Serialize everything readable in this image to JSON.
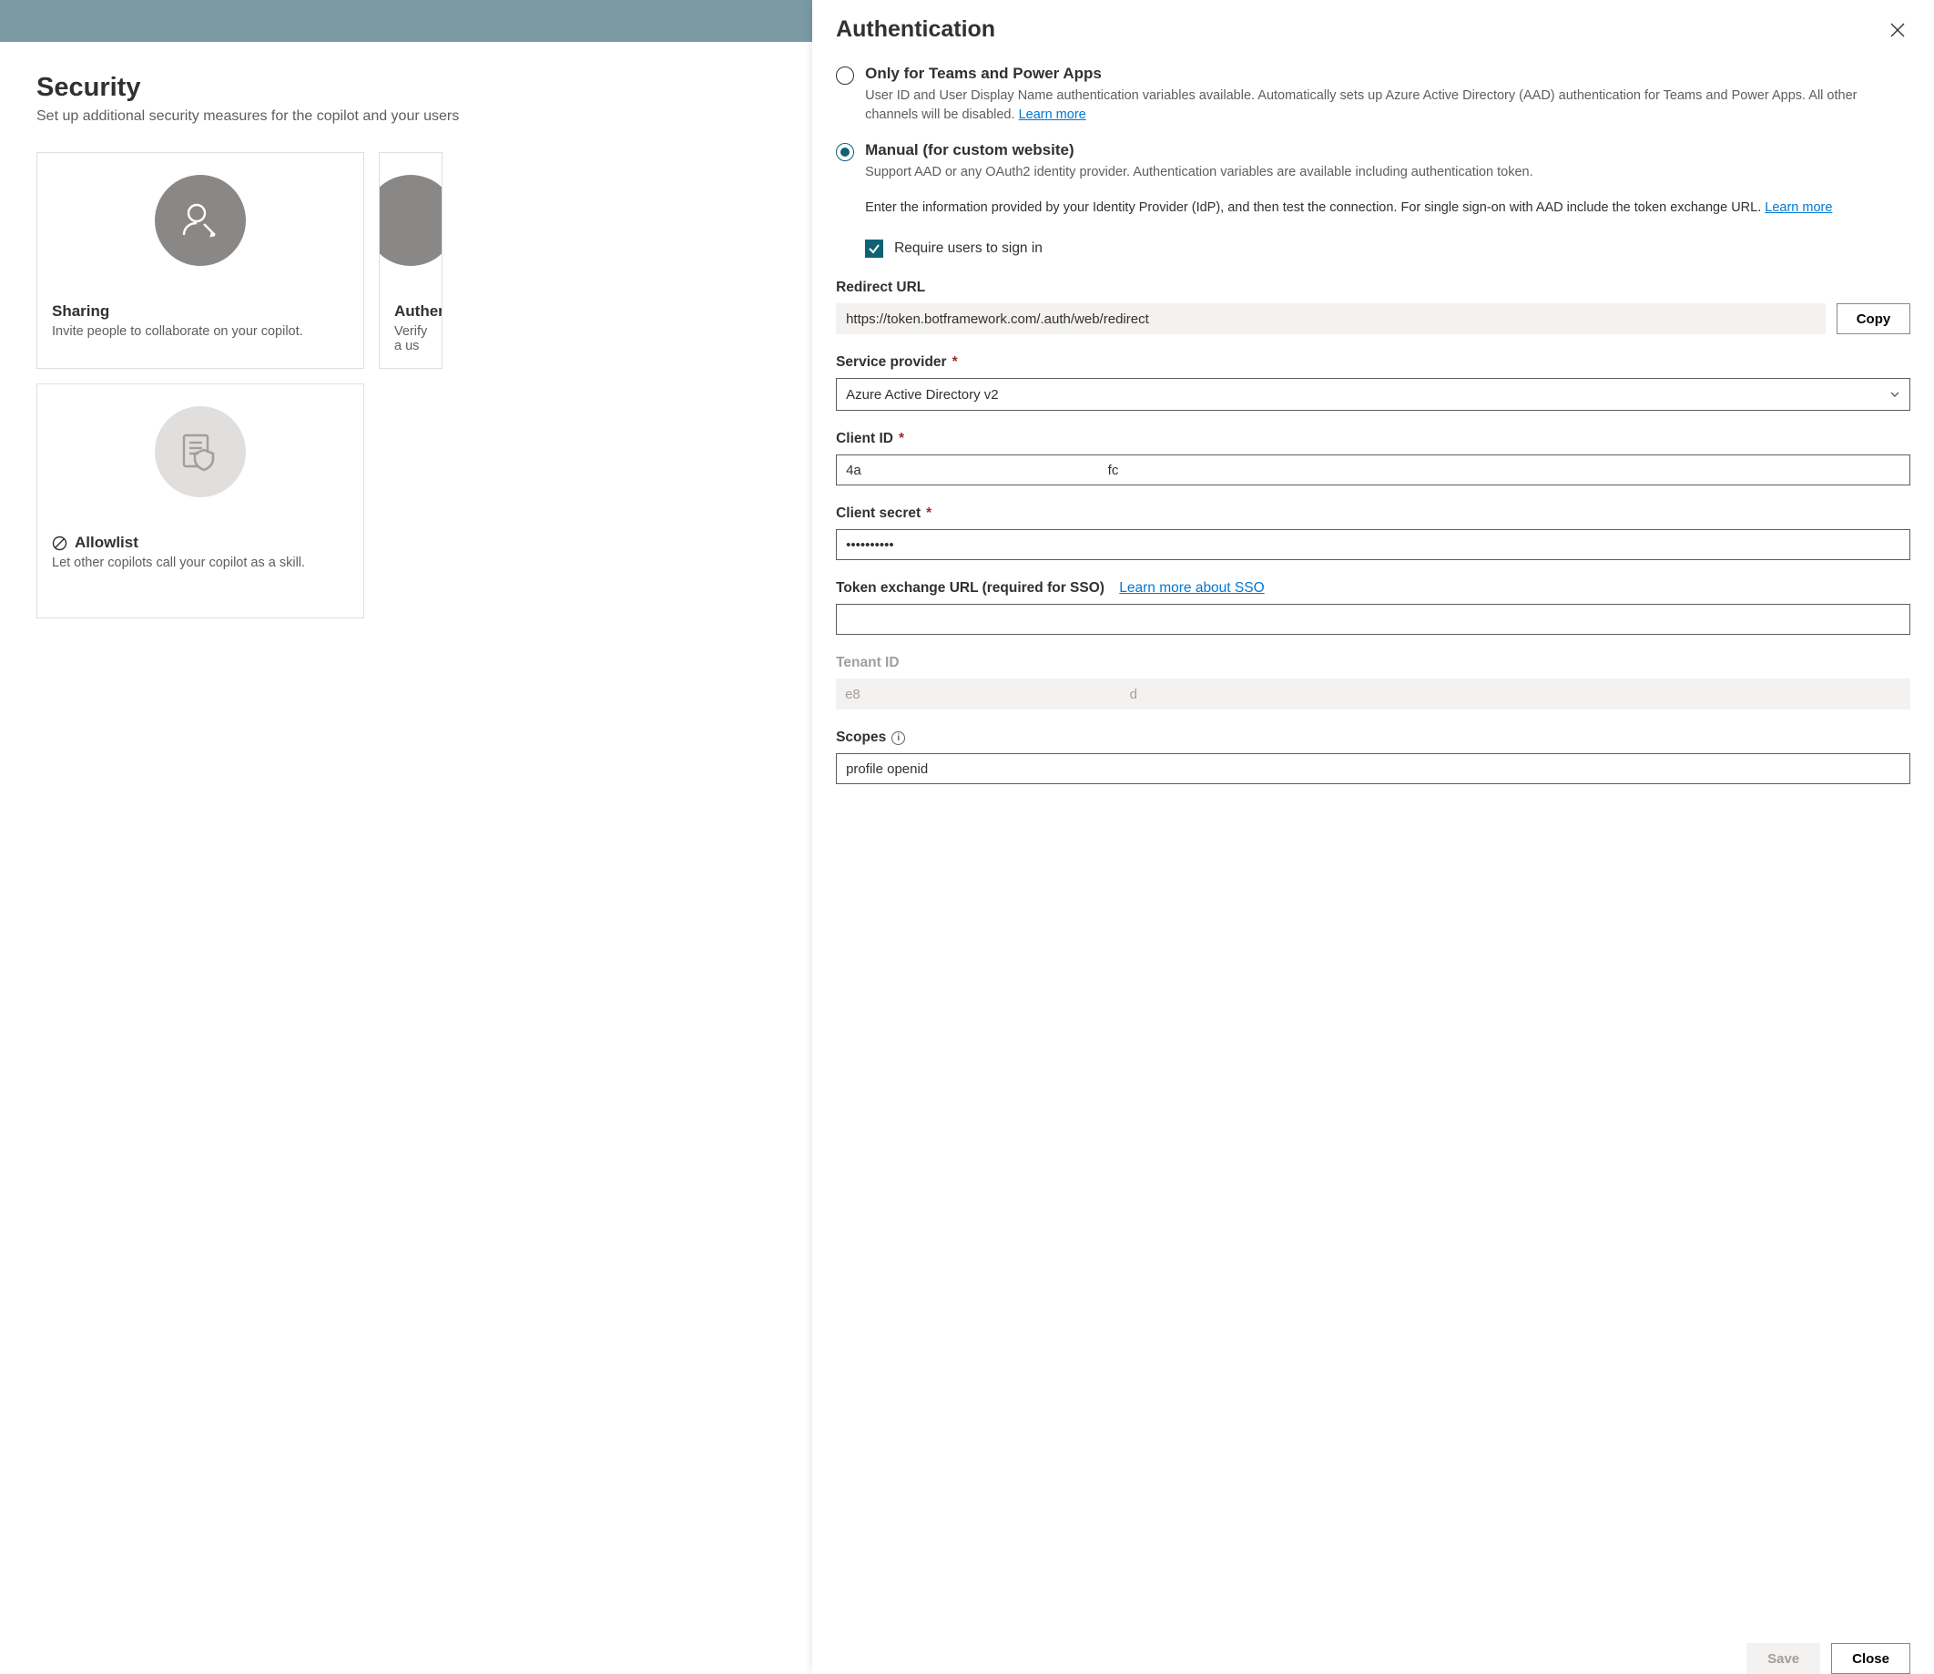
{
  "page": {
    "title": "Security",
    "subtitle": "Set up additional security measures for the copilot and your users"
  },
  "cards": {
    "sharing": {
      "title": "Sharing",
      "desc": "Invite people to collaborate on your copilot."
    },
    "auth": {
      "title": "Authenti",
      "desc": "Verify a us"
    },
    "allow": {
      "title": "Allowlist",
      "desc": "Let other copilots call your copilot as a skill."
    }
  },
  "panel": {
    "title": "Authentication",
    "option_teams": {
      "label": "Only for Teams and Power Apps",
      "desc_pre": "User ID and User Display Name authentication variables available. Automatically sets up Azure Active Directory (AAD) authentication for Teams and Power Apps. All other channels will be disabled. ",
      "learn_more": "Learn more"
    },
    "option_manual": {
      "label": "Manual (for custom website)",
      "desc": "Support AAD or any OAuth2 identity provider. Authentication variables are available including authentication token."
    },
    "idp_para_pre": "Enter the information provided by your Identity Provider (IdP), and then test the connection. For single sign-on with AAD include the token exchange URL. ",
    "idp_learn_more": "Learn more",
    "require_signin": "Require users to sign in",
    "redirect": {
      "label": "Redirect URL",
      "value": "https://token.botframework.com/.auth/web/redirect",
      "copy": "Copy"
    },
    "provider": {
      "label": "Service provider",
      "value": "Azure Active Directory v2"
    },
    "client_id": {
      "label": "Client ID",
      "value": "4a                                                                 fc"
    },
    "client_secret": {
      "label": "Client secret",
      "value": "••••••••••"
    },
    "token_ex": {
      "label": "Token exchange URL (required for SSO)",
      "link": "Learn more about SSO",
      "value": ""
    },
    "tenant": {
      "label": "Tenant ID",
      "value": "e8                                                                       d"
    },
    "scopes": {
      "label": "Scopes",
      "value": "profile openid"
    },
    "buttons": {
      "save": "Save",
      "close": "Close"
    }
  }
}
